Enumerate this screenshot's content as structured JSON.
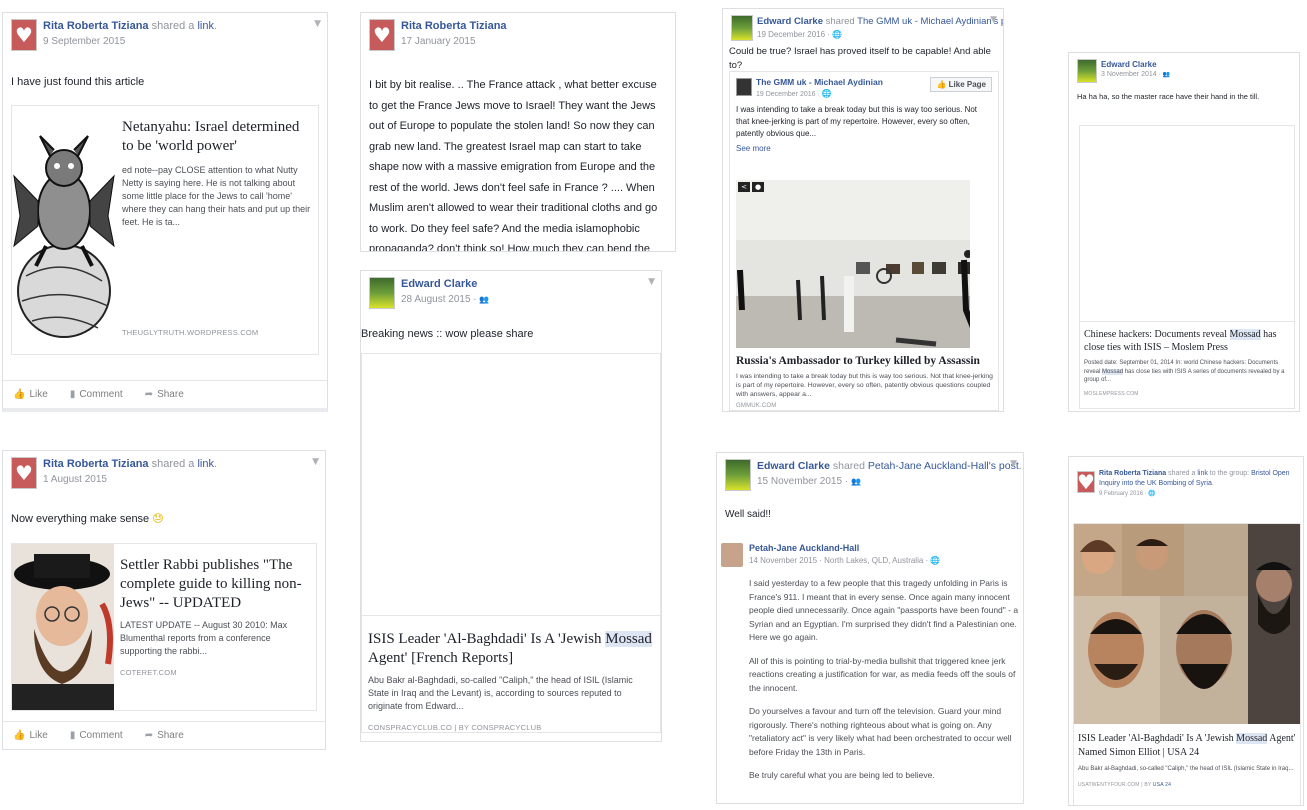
{
  "post1": {
    "author": "Rita Roberta Tiziana",
    "action": "shared a",
    "action_link": "link",
    "action_end": ".",
    "date": "9 September 2015",
    "text": "I have just found this article",
    "attachment": {
      "title": "Netanyahu: Israel determined to be 'world power'",
      "desc": "ed note--pay CLOSE attention to what Nutty Netty is saying here. He is not talking about some little place for the Jews to call 'home' where they can hang their hats and put up their feet. He is ta...",
      "source": "THEUGLYTRUTH.WORDPRESS.COM"
    },
    "actions": {
      "like": "Like",
      "comment": "Comment",
      "share": "Share"
    }
  },
  "post2": {
    "author": "Rita Roberta Tiziana",
    "date": "17 January 2015",
    "text": "I bit by bit realise. .. The France attack , what better excuse to get the France Jews move to Israel! They want the Jews out of Europe to populate the stolen land! So now they can grab new land. The greatest Israel map can start to take shape now with a massive emigration from Europe and the rest of the world. Jews don't feel safe in France ? .... When Muslim aren't allowed to wear their traditional cloths and go to work. Do they feel safe? And the media islamophobic propaganda? don't think so! How much they can bend the head to please the country they live in The Muslims"
  },
  "post3": {
    "author": "Rita Roberta Tiziana",
    "action": "shared a",
    "action_link": "link",
    "action_end": ".",
    "date": "1 August 2015",
    "text": "Now everything make sense",
    "emoji": "😓",
    "attachment": {
      "title": "Settler Rabbi publishes \"The complete guide to killing non-Jews\" -- UPDATED",
      "desc": "LATEST UPDATE -- August 30 2010: Max Blumenthal reports from a conference supporting the rabbi...",
      "source": "COTERET.COM"
    },
    "actions": {
      "like": "Like",
      "comment": "Comment",
      "share": "Share"
    }
  },
  "post4": {
    "author": "Edward Clarke",
    "date": "28 August 2015",
    "text": "Breaking news :: wow please share",
    "attachment": {
      "title_pre": "ISIS Leader 'Al-Baghdadi' Is A 'Jewish ",
      "title_hl": "Mossad",
      "title_post": " Agent' [French Reports]",
      "desc": "Abu Bakr al-Baghdadi, so-called \"Caliph,\" the head of ISIL (Islamic State in Iraq and the Levant) is, according to sources reputed to originate from Edward...",
      "source": "CONSPRACYCLUB.CO | BY CONSPRACYCLUB"
    }
  },
  "post5": {
    "author": "Edward Clarke",
    "action": "shared",
    "action_link": "The GMM uk - Michael Aydinian's post",
    "action_end": ".",
    "date": "19 December 2016",
    "text": "Could be true? Israel has proved itself to be capable! And able to?",
    "inner": {
      "page": "The GMM uk - Michael Aydinian",
      "date": "19 December 2016",
      "like_page": "Like Page",
      "text": "I was intending to take a break today but this is way too serious. Not that knee-jerking is part of my repertoire. However, every so often, patently obvious que...",
      "see_more": "See more"
    },
    "attachment": {
      "title": "Russia's Ambassador to Turkey killed by Assassin",
      "desc": "I was intending to take a break today but this is way too serious. Not that knee-jerking is part of my repertoire. However, every so often, patently obvious questions coupled with answers, appear a...",
      "source": "GMMUK.COM"
    }
  },
  "post6": {
    "author": "Edward Clarke",
    "action": "shared",
    "action_link": "Petah-Jane Auckland-Hall's post",
    "action_end": ".",
    "date": "15 November 2015",
    "text": "Well said!!",
    "inner": {
      "author": "Petah-Jane Auckland-Hall",
      "meta": "14 November 2015 · North Lakes, QLD, Australia",
      "paragraphs": [
        "I said yesterday to a few people that this tragedy unfolding in Paris is France's 911. I meant that in every sense. Once again many innocent people died unnecessarily. Once again \"passports have been found\" - a Syrian and an Egyptian. I'm surprised they didn't find a Palestinian one. Here we go again.",
        "All of this is pointing to trial-by-media bullshit that triggered knee jerk reactions creating a justification for war, as media feeds off the souls of the innocent.",
        "Do yourselves a favour and turn off the television. Guard your mind rigorously. There's nothing righteous about what is going on. Any \"retaliatory act\" is very likely what had been orchestrated to occur well before Friday the 13th in Paris.",
        "Be truly careful what you are being led to believe."
      ]
    }
  },
  "post7": {
    "author": "Edward Clarke",
    "date": "3 November 2014",
    "text": "Ha ha ha, so the master race have their hand in the till.",
    "attachment": {
      "title_pre": "Chinese hackers: Documents reveal ",
      "title_hl": "Mossad",
      "title_post": " has close ties with ISIS – Moslem Press",
      "desc_pre": "Posted date: September 01, 2014 In: world Chinese hackers: Documents reveal ",
      "desc_hl": "Mossad",
      "desc_post": " has close ties with ISIS A series of documents revealed by a group of...",
      "source": "MOSLEMPRESS.COM"
    }
  },
  "post8": {
    "author": "Rita Roberta Tiziana",
    "action": "shared a",
    "action_link": "link",
    "action_mid": "to the group:",
    "group": "Bristol Open Inquiry into the UK Bombing of Syria",
    "action_end": ".",
    "date": "9 February 2016",
    "attachment": {
      "title_pre": "ISIS Leader 'Al-Baghdadi' Is A 'Jewish ",
      "title_hl": "Mossad",
      "title_post": " Agent' Named Simon Elliot | USA 24",
      "desc": "Abu Bakr al-Baghdadi, so-called \"Caliph,\" the head of ISIL (Islamic State in Iraq...",
      "source": "USATWENTYFOUR.COM | BY",
      "source_link": "USA 24"
    }
  }
}
